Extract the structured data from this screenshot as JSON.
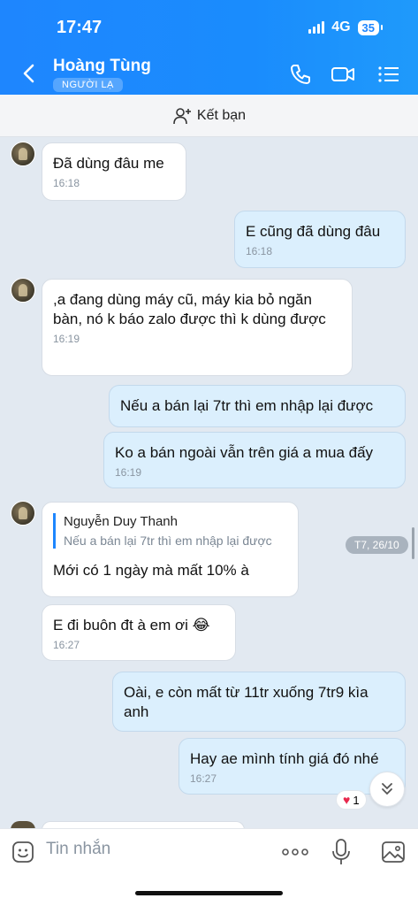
{
  "status": {
    "time": "17:47",
    "network": "4G",
    "battery": "35"
  },
  "header": {
    "name": "Hoàng Tùng",
    "tag": "NGƯỜI LẠ"
  },
  "addfriend": {
    "label": "Kết bạn"
  },
  "messages": [
    {
      "text": "Đã dùng đâu me",
      "time": "16:18"
    },
    {
      "text": "E cũng đã dùng đâu",
      "time": "16:18"
    },
    {
      "text": ",a đang dùng máy cũ, máy kia bỏ ngăn bàn, nó k báo zalo được thì k dùng được",
      "time": "16:19"
    },
    {
      "text": "Nếu a bán lại 7tr thì em nhập lại được"
    },
    {
      "text": "Ko a bán ngoài vẫn trên giá a mua đấy",
      "time": "16:19"
    },
    {
      "quote_name": "Nguyễn Duy Thanh",
      "quote_text": "Nếu a bán lại 7tr thì em nhập lại được",
      "text": "Mới có 1 ngày mà mất 10% à"
    },
    {
      "text": "E đi buôn đt à em ơi 😂",
      "time": "16:27"
    },
    {
      "text": "Oài, e còn mất từ 11tr xuống 7tr9 kìa anh"
    },
    {
      "text": "Hay ae mình tính giá đó nhé",
      "time": "16:27"
    }
  ],
  "date_pill": "T7, 26/10",
  "reaction": {
    "count": "1"
  },
  "input": {
    "placeholder": "Tin nhắn"
  },
  "colors": {
    "header_blue": "#1e86fe",
    "outgoing_bubble": "#dbeffd",
    "incoming_bubble": "#ffffff",
    "background": "#e2e9f1"
  }
}
